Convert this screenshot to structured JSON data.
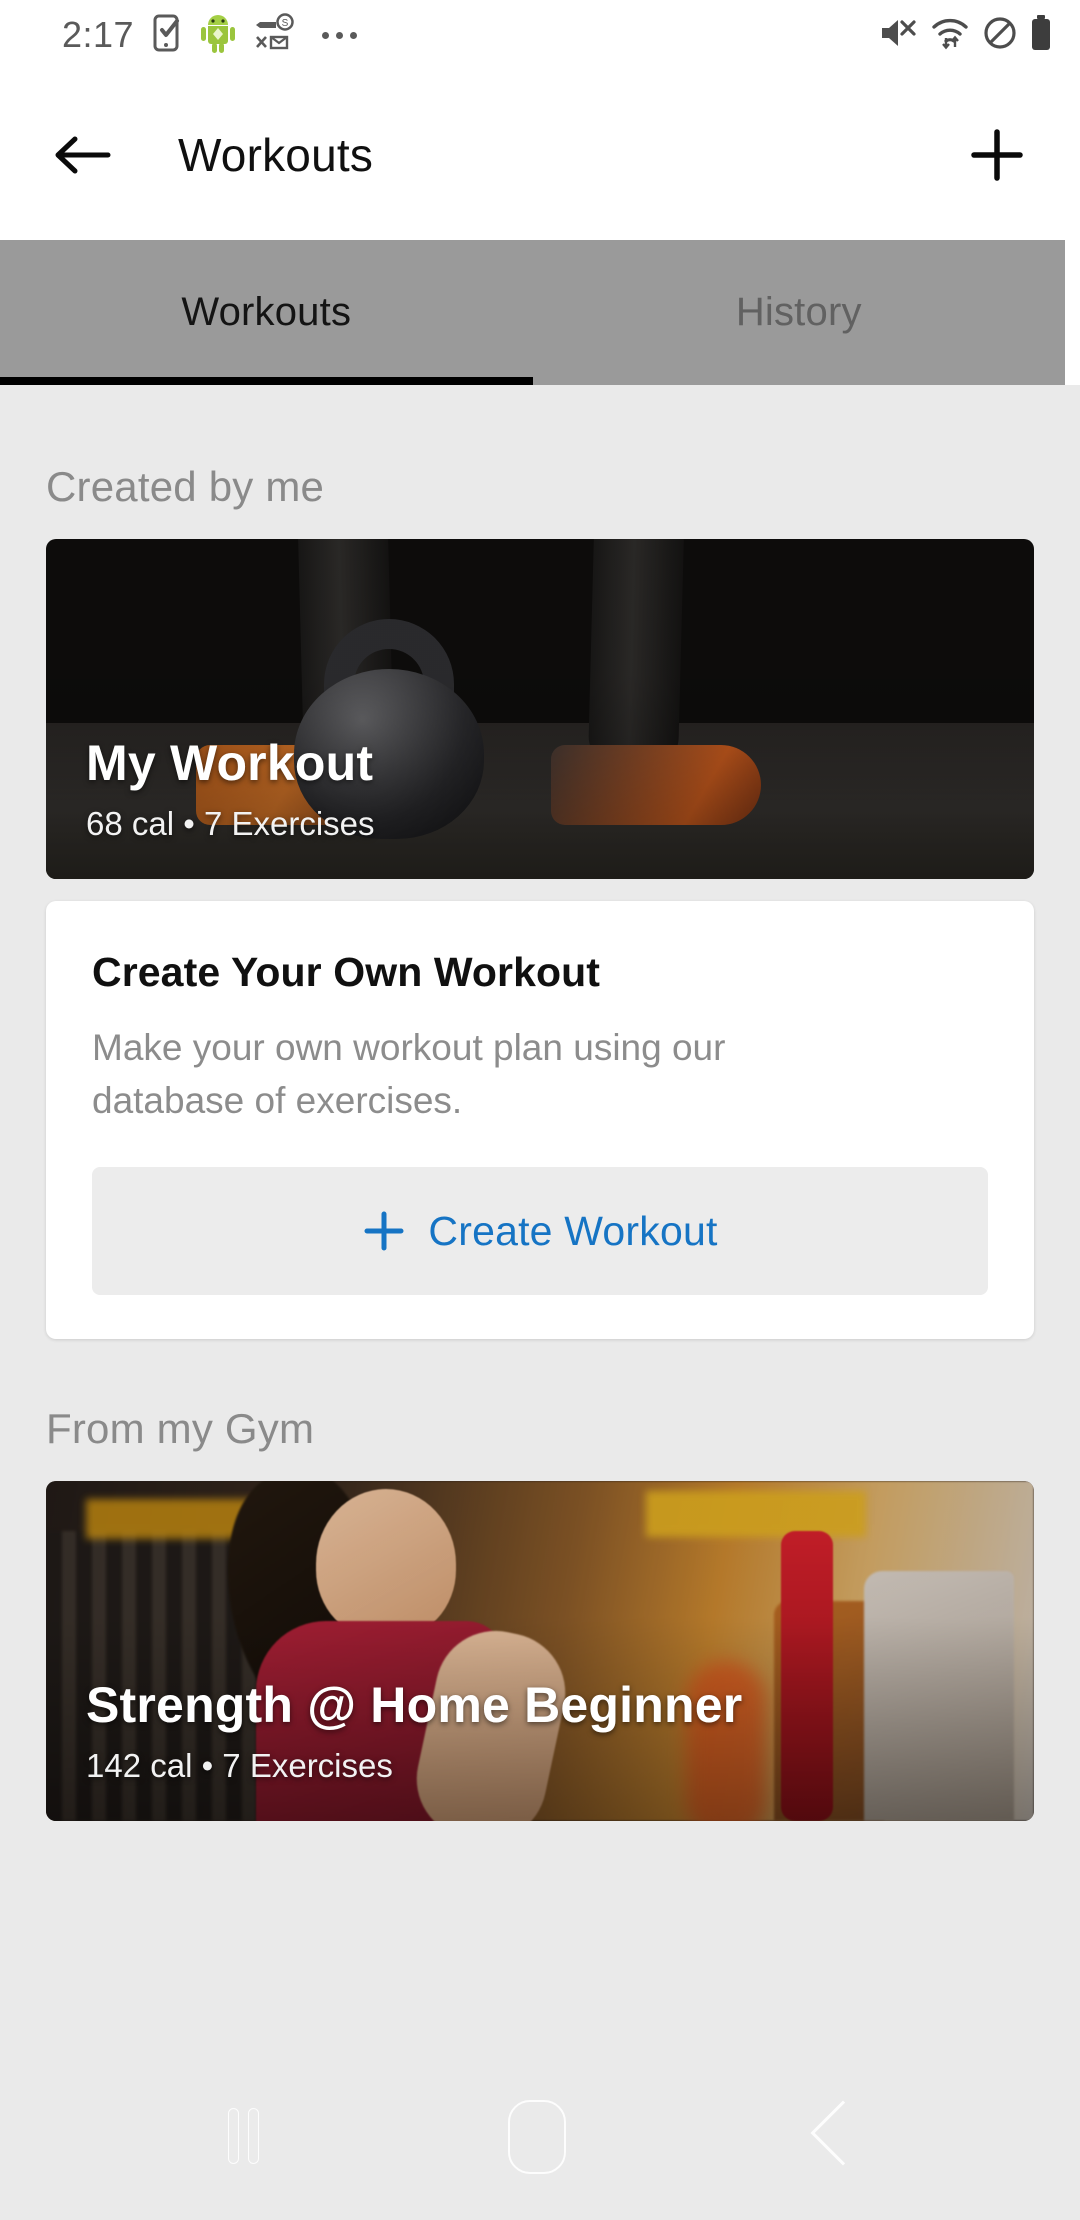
{
  "status_bar": {
    "time": "2:17",
    "left_icons": [
      "phone-check-icon",
      "android-robot-icon",
      "key-mail-icon",
      "overflow-dots-icon"
    ],
    "right_icons": [
      "mute-icon",
      "wifi-icon",
      "do-not-disturb-icon",
      "battery-full-icon"
    ]
  },
  "app_bar": {
    "back_label": "back-arrow",
    "title": "Workouts",
    "add_label": "add"
  },
  "tabs": {
    "items": [
      {
        "label": "Workouts",
        "active": true
      },
      {
        "label": "History",
        "active": false
      }
    ],
    "indicator_color": "#000000",
    "bar_color": "#9a9a9a"
  },
  "sections": [
    {
      "title": "Created by me",
      "hero": {
        "title": "My Workout",
        "subtitle": "68 cal • 7 Exercises",
        "calories": "68 cal",
        "exercises": "7 Exercises",
        "image": "kettlebell-dark-gym-photo"
      },
      "create_card": {
        "title": "Create Your Own Workout",
        "description": "Make your own workout plan using our database of exercises.",
        "button_label": "Create Workout",
        "button_icon": "plus-icon",
        "accent_color": "#1674c4"
      }
    },
    {
      "title": "From my Gym",
      "hero": {
        "title": "Strength @ Home Beginner",
        "subtitle": "142 cal • 7 Exercises",
        "calories": "142 cal",
        "exercises": "7 Exercises",
        "image": "woman-treadmill-gym-photo"
      }
    }
  ],
  "nav_overlay": {
    "recents": "recents-icon",
    "home": "home-icon",
    "back": "back-icon"
  },
  "theme": {
    "page_bg": "#eaeaea",
    "card_bg": "#ffffff",
    "section_title_color": "#8a8a8a",
    "accent": "#1674c4"
  }
}
